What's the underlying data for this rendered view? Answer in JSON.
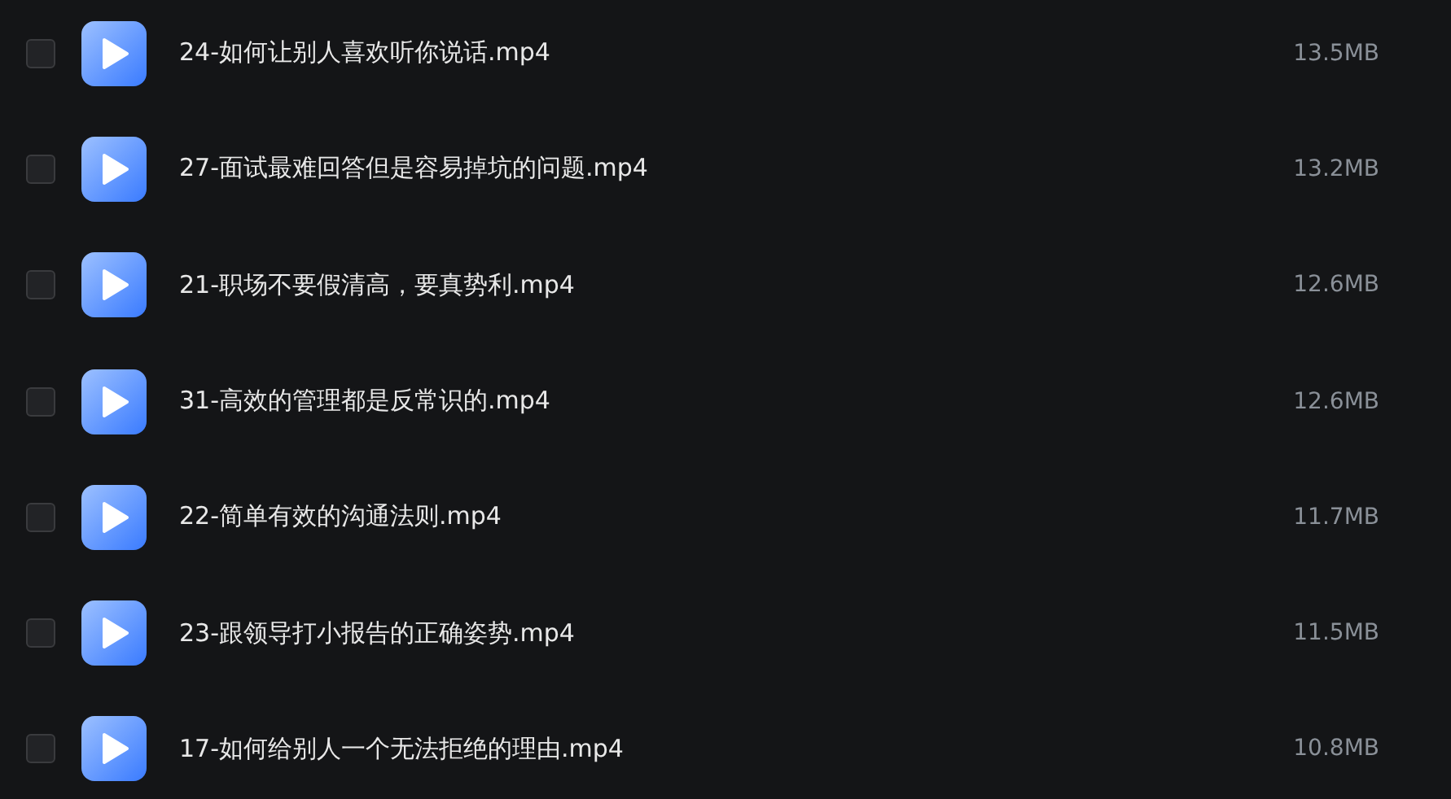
{
  "files": [
    {
      "name": "24-如何让别人喜欢听你说话.mp4",
      "size": "13.5MB",
      "checked": false
    },
    {
      "name": "27-面试最难回答但是容易掉坑的问题.mp4",
      "size": "13.2MB",
      "checked": false
    },
    {
      "name": "21-职场不要假清高，要真势利.mp4",
      "size": "12.6MB",
      "checked": false
    },
    {
      "name": "31-高效的管理都是反常识的.mp4",
      "size": "12.6MB",
      "checked": false
    },
    {
      "name": "22-简单有效的沟通法则.mp4",
      "size": "11.7MB",
      "checked": false
    },
    {
      "name": "23-跟领导打小报告的正确姿势.mp4",
      "size": "11.5MB",
      "checked": false
    },
    {
      "name": "17-如何给别人一个无法拒绝的理由.mp4",
      "size": "10.8MB",
      "checked": false
    }
  ]
}
